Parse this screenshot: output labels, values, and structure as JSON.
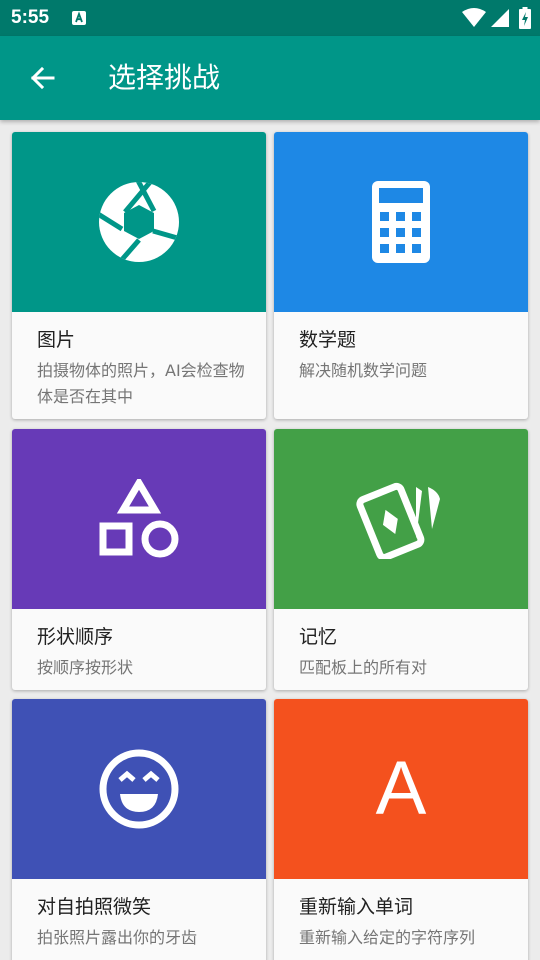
{
  "status_bar": {
    "time": "5:55",
    "notification_icon": "app-notification-icon",
    "icons": [
      "wifi-icon",
      "signal-icon",
      "battery-charging-icon"
    ]
  },
  "app_bar": {
    "back_icon": "arrow-back-icon",
    "title": "选择挑战",
    "color": "#009688",
    "status_color": "#00796b"
  },
  "challenges": [
    {
      "title": "图片",
      "description": "拍摄物体的照片，AI会检查物体是否在其中",
      "icon": "camera-shutter-icon",
      "color": "#009688"
    },
    {
      "title": "数学题",
      "description": "解决随机数学问题",
      "icon": "calculator-icon",
      "color": "#1e88e5"
    },
    {
      "title": "形状顺序",
      "description": "按顺序按形状",
      "icon": "shapes-icon",
      "color": "#673ab7"
    },
    {
      "title": "记忆",
      "description": "匹配板上的所有对",
      "icon": "cards-icon",
      "color": "#43a047"
    },
    {
      "title": "对自拍照微笑",
      "description": "拍张照片露出你的牙齿",
      "icon": "smile-face-icon",
      "color": "#3f51b5"
    },
    {
      "title": "重新输入单词",
      "description": "重新输入给定的字符序列",
      "icon": "letter-a-icon",
      "icon_text": "A",
      "color": "#f4511e"
    }
  ]
}
